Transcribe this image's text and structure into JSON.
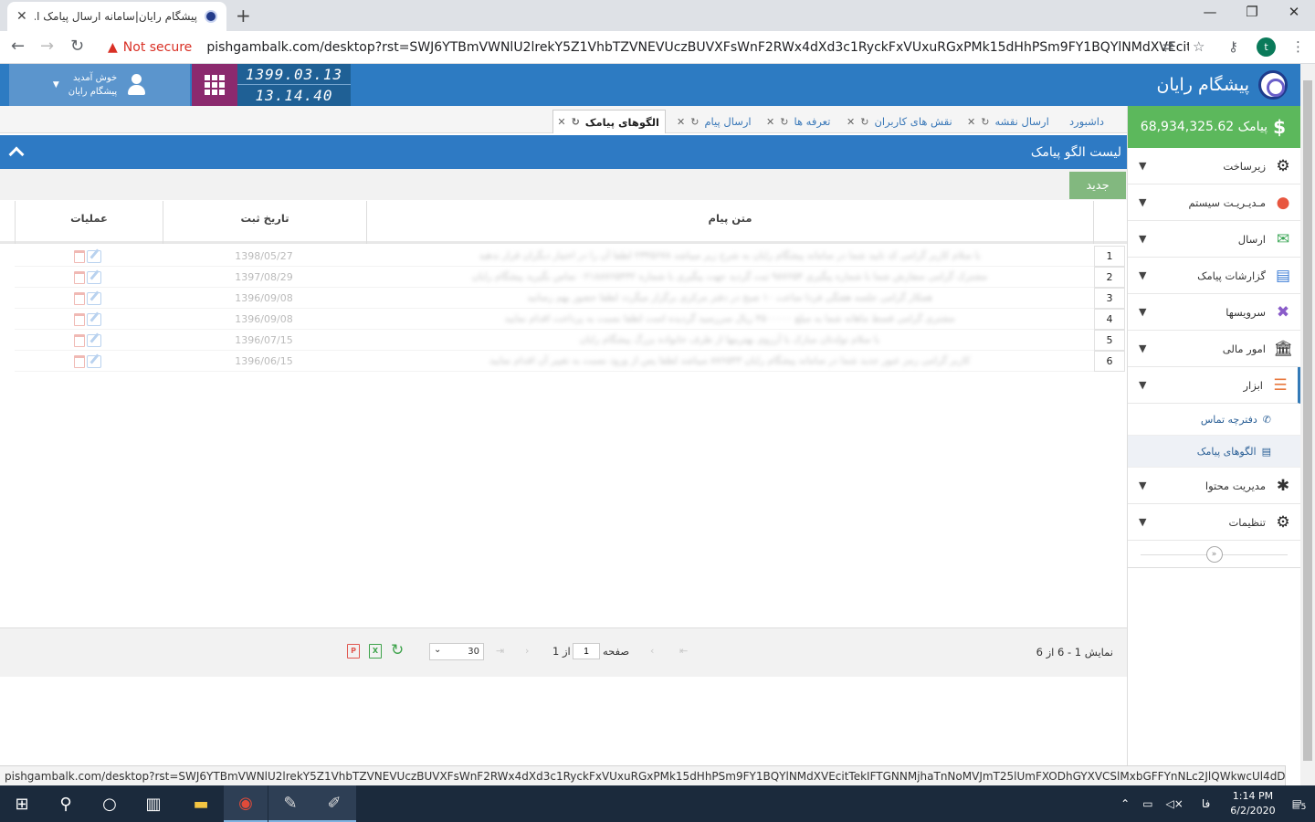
{
  "browser": {
    "tab_title": "پیشگام رایان|سامانه ارسال پیامک ا...",
    "not_secure": "Not secure",
    "url": "pishgambalk.com/desktop?rst=SWJ6YTBmVWNlU2lrekY5Z1VhbTZVNEVUczBUVXFsWnF2RWx4dXd3c1RyckFxVUxuRGxPMk15dHhPSm9FY1BQYlNMdXVEcitTekIFTGN...",
    "avatar_letter": "t"
  },
  "header": {
    "brand": "پیشگام رایان",
    "welcome": "خوش آمدید",
    "user": "پیشگام رایان",
    "date": "1399.03.13",
    "time": "13.14.40"
  },
  "sidebar": {
    "credit": "68,934,325.62 پیامک",
    "items": [
      {
        "label": "زیرساخت"
      },
      {
        "label": "مـدیـریـت سیستم"
      },
      {
        "label": "ارسال"
      },
      {
        "label": "گزارشات پیامک"
      },
      {
        "label": "سرویسها"
      },
      {
        "label": "امور مالی"
      },
      {
        "label": "ابزار"
      }
    ],
    "subitems": [
      {
        "label": "دفترچه تماس"
      },
      {
        "label": "الگوهای پیامک"
      }
    ],
    "items2": [
      {
        "label": "مدیریت محتوا"
      },
      {
        "label": "تنظیمات"
      }
    ]
  },
  "tabs": [
    {
      "label": "داشبورد"
    },
    {
      "label": "ارسال نقشه"
    },
    {
      "label": "نقش های کاربران"
    },
    {
      "label": "تعرفه ها"
    },
    {
      "label": "ارسال پیام"
    },
    {
      "label": "الگوهای پیامک"
    }
  ],
  "panel": {
    "title": "لیست الگو پیامک",
    "new_label": "جدید",
    "col_msg": "متن پیام",
    "col_date": "تاریخ ثبت",
    "col_ops": "عملیات"
  },
  "rows": [
    {
      "num": "1",
      "date": "1398/05/27",
      "msg": "با سلام کاربر گرامی کد تایید شما در سامانه پیشگام رایان به شرح زیر میباشد ۲۳۴۵۶۷۸ لطفا آن را در اختیار دیگران قرار ندهید"
    },
    {
      "num": "2",
      "date": "1397/08/29",
      "msg": "مشترک گرامی سفارش شما با شماره پیگیری ۹۸۷۶۵۴ ثبت گردید جهت پیگیری با شماره ۰۲۱۸۸۷۶۵۴۳۲ تماس بگیرید پیشگام رایان"
    },
    {
      "num": "3",
      "date": "1396/09/08",
      "msg": "همکار گرامی جلسه هفتگی فردا ساعت ۱۰ صبح در دفتر مرکزی برگزار میگردد لطفا حضور بهم رسانید"
    },
    {
      "num": "4",
      "date": "1396/09/08",
      "msg": "مشتری گرامی قسط ماهانه شما به مبلغ ۴۵۰۰۰۰۰ ریال سررسید گردیده است لطفا نسبت به پرداخت اقدام نمایید"
    },
    {
      "num": "5",
      "date": "1396/07/15",
      "msg": "با سلام تولدتان مبارک با آرزوی بهترینها از طرف خانواده بزرگ پیشگام رایان"
    },
    {
      "num": "6",
      "date": "1396/06/15",
      "msg": "کاربر گرامی رمز عبور جدید شما در سامانه پیشگام رایان ۸۷۶۵۴۳ میباشد لطفا پس از ورود نسبت به تغییر آن اقدام نمایید"
    }
  ],
  "pager": {
    "summary": "نمایش 1 - 6 از 6",
    "page_label": "صفحه",
    "page_value": "1",
    "of_label": "از 1",
    "page_size": "30"
  },
  "status_url": "pishgambalk.com/desktop?rst=SWJ6YTBmVWNlU2lrekY5Z1VhbTZVNEVUczBUVXFsWnF2RWx4dXd3c1RyckFxVUxuRGxPMk15dHhPSm9FY1BQYlNMdXVEcitTekIFTGNNMjhaTnNoMVJmT25lUmFXODhGYXVCSlMxbGFFYnNLc2JlQWkwcUl4dDVOZk41ODhacnVlVDRXc...",
  "taskbar": {
    "time": "1:14 PM",
    "date": "6/2/2020",
    "lang": "فا",
    "notif": "5"
  }
}
